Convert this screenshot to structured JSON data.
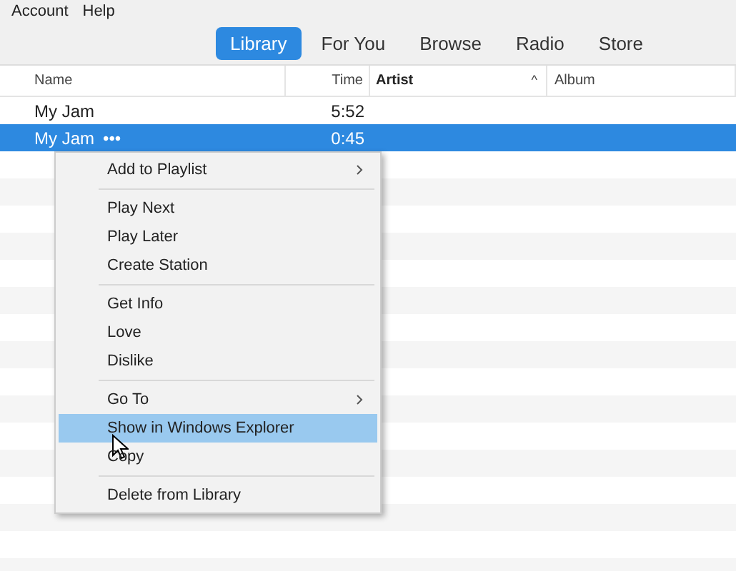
{
  "menu_bar": [
    "Account",
    "Help"
  ],
  "tabs": [
    {
      "label": "Library",
      "selected": true
    },
    {
      "label": "For You",
      "selected": false
    },
    {
      "label": "Browse",
      "selected": false
    },
    {
      "label": "Radio",
      "selected": false
    },
    {
      "label": "Store",
      "selected": false
    }
  ],
  "table": {
    "columns": [
      {
        "label": "Name",
        "sorted": false
      },
      {
        "label": "Time",
        "sorted": false
      },
      {
        "label": "Artist",
        "sorted": true
      },
      {
        "label": "Album",
        "sorted": false
      }
    ],
    "sort_indicator": "^",
    "rows": [
      {
        "name": "My Jam",
        "time": "5:52",
        "selected": false
      },
      {
        "name": "My Jam",
        "more": "•••",
        "time": "0:45",
        "selected": true
      }
    ]
  },
  "context_menu": [
    {
      "kind": "item",
      "label": "Add to Playlist",
      "submenu": true,
      "selected": false
    },
    {
      "kind": "separator"
    },
    {
      "kind": "item",
      "label": "Play Next",
      "submenu": false,
      "selected": false
    },
    {
      "kind": "item",
      "label": "Play Later",
      "submenu": false,
      "selected": false
    },
    {
      "kind": "item",
      "label": "Create Station",
      "submenu": false,
      "selected": false
    },
    {
      "kind": "separator"
    },
    {
      "kind": "item",
      "label": "Get Info",
      "submenu": false,
      "selected": false
    },
    {
      "kind": "item",
      "label": "Love",
      "submenu": false,
      "selected": false
    },
    {
      "kind": "item",
      "label": "Dislike",
      "submenu": false,
      "selected": false
    },
    {
      "kind": "separator"
    },
    {
      "kind": "item",
      "label": "Go To",
      "submenu": true,
      "selected": false
    },
    {
      "kind": "item",
      "label": "Show in Windows Explorer",
      "submenu": false,
      "selected": true
    },
    {
      "kind": "item",
      "label": "Copy",
      "submenu": false,
      "selected": false
    },
    {
      "kind": "separator"
    },
    {
      "kind": "item",
      "label": "Delete from Library",
      "submenu": false,
      "selected": false
    }
  ]
}
